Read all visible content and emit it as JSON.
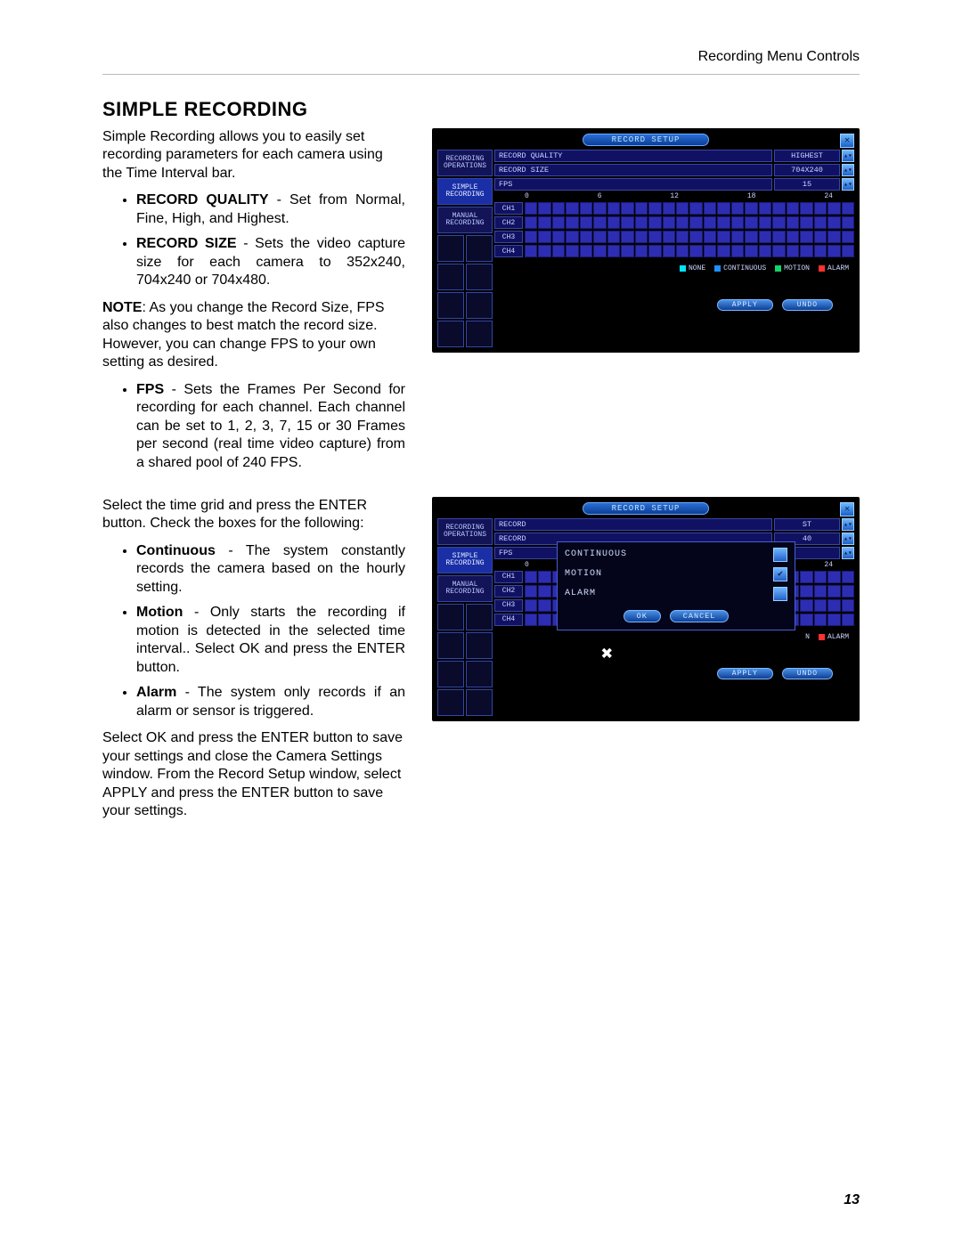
{
  "header": {
    "right": "Recording Menu Controls"
  },
  "title": "SIMPLE RECORDING",
  "intro": "Simple Recording allows you to easily set recording parameters for each camera using the Time Interval bar.",
  "b1": {
    "label": "RECORD QUALITY",
    "text": " - Set from Normal, Fine, High, and Highest."
  },
  "b2": {
    "label": "RECORD SIZE",
    "text": " - Sets the video capture size for each camera to 352x240, 704x240 or 704x480."
  },
  "note": {
    "label": "NOTE",
    "text": ": As you change the Record Size, FPS also changes to best match the record size. However, you can change FPS to your own setting as desired."
  },
  "b3": {
    "label": "FPS",
    "text": " - Sets the Frames Per Second for recording for each channel. Each channel can be set to 1, 2, 3, 7, 15 or 30 Frames per second (real time video capture) from a shared pool of 240 FPS."
  },
  "para2": "Select the time grid and press the ENTER button. Check the boxes for the following:",
  "b4": {
    "label": "Continuous",
    "text": " - The system constantly records the camera based on the hourly setting."
  },
  "b5": {
    "label": "Motion",
    "text": " - Only starts the recording if motion is detected in the selected time interval.. Select OK and press the ENTER button."
  },
  "b6": {
    "label": "Alarm",
    "text": " - The system only records if an alarm or sensor is triggered."
  },
  "para3": "Select OK and press the ENTER button to save your settings and close the Camera Settings window. From the Record Setup window, select APPLY and press the ENTER button to save your settings.",
  "page_no": "13",
  "shot1": {
    "title": "RECORD SETUP",
    "side": {
      "rec_ops": "RECORDING\nOPERATIONS",
      "simple": "SIMPLE\nRECORDING",
      "manual": "MANUAL\nRECORDING"
    },
    "rows": {
      "quality_label": "RECORD QUALITY",
      "quality_value": "HIGHEST",
      "size_label": "RECORD SIZE",
      "size_value": "704X240",
      "fps_label": "FPS",
      "fps_value": "15"
    },
    "ticks": [
      "0",
      "6",
      "12",
      "18",
      "24"
    ],
    "channels": [
      "CH1",
      "CH2",
      "CH3",
      "CH4"
    ],
    "legend": {
      "none": "NONE",
      "continuous": "CONTINUOUS",
      "motion": "MOTION",
      "alarm": "ALARM"
    },
    "apply": "APPLY",
    "undo": "UNDO"
  },
  "shot2": {
    "title": "RECORD SETUP",
    "side": {
      "rec_ops": "RECORDING\nOPERATIONS",
      "simple": "SIMPLE\nRECORDING",
      "manual": "MANUAL\nRECORDING"
    },
    "rows": {
      "quality_label": "RECORD",
      "quality_value": "ST",
      "size_label": "RECORD",
      "size_value": "40",
      "fps_label": "FPS",
      "fps_value": ""
    },
    "ticks": [
      "0",
      "",
      "",
      "",
      "24"
    ],
    "channels": [
      "CH1",
      "CH2",
      "CH3",
      "CH4"
    ],
    "legend": {
      "n": "N",
      "alarm": "ALARM"
    },
    "popup": {
      "continuous": "CONTINUOUS",
      "motion": "MOTION",
      "alarm": "ALARM",
      "ok": "OK",
      "cancel": "CANCEL"
    },
    "apply": "APPLY",
    "undo": "UNDO"
  }
}
